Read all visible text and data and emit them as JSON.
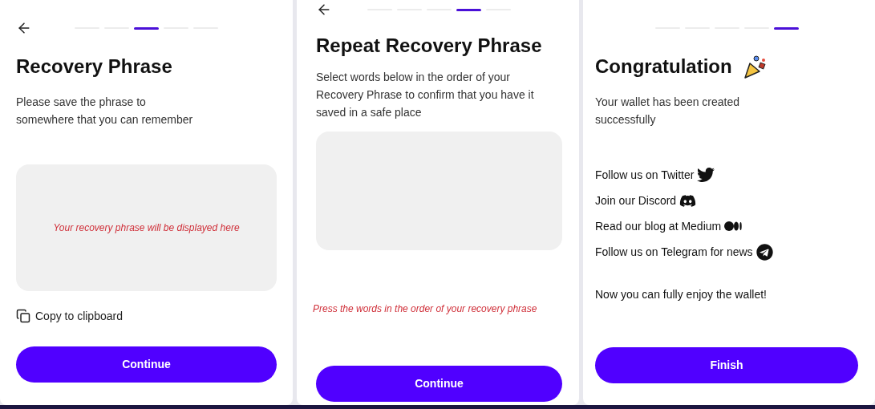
{
  "screens": [
    {
      "kind": "phrase",
      "back": true,
      "steps": [
        {
          "selected": false
        },
        {
          "selected": false
        },
        {
          "selected": true
        },
        {
          "selected": false
        },
        {
          "selected": false
        }
      ],
      "title": "Recovery Phrase",
      "description": "Please save the phrase to somewhere that you can remember",
      "box_message": "Your recovery phrase will be displayed here",
      "copy_link": "Copy to clipboard",
      "button": "Continue"
    },
    {
      "kind": "confirm",
      "back": true,
      "steps": [
        {
          "selected": false
        },
        {
          "selected": false
        },
        {
          "selected": false
        },
        {
          "selected": true
        },
        {
          "selected": false
        }
      ],
      "title": "Repeat Recovery Phrase",
      "description": "Select words below in the order of your Recovery Phrase to confirm that you have it saved in a safe place",
      "hint": "Press the words in the order of your recovery phrase",
      "button": "Continue"
    },
    {
      "kind": "done",
      "back": false,
      "steps": [
        {
          "selected": false
        },
        {
          "selected": false
        },
        {
          "selected": false
        },
        {
          "selected": false
        },
        {
          "selected": true
        }
      ],
      "title": "Congratulation",
      "description": "Your wallet has been created successfully",
      "links": [
        {
          "kind": "twitter",
          "label": "Follow us on Twitter"
        },
        {
          "kind": "discord",
          "label": "Join our Discord"
        },
        {
          "kind": "medium",
          "label": "Read our blog at Medium"
        },
        {
          "kind": "telegram",
          "label": "Follow us on Telegram for news"
        }
      ],
      "closing": "Now you can fully enjoy the wallet!",
      "button": "Finish"
    }
  ]
}
